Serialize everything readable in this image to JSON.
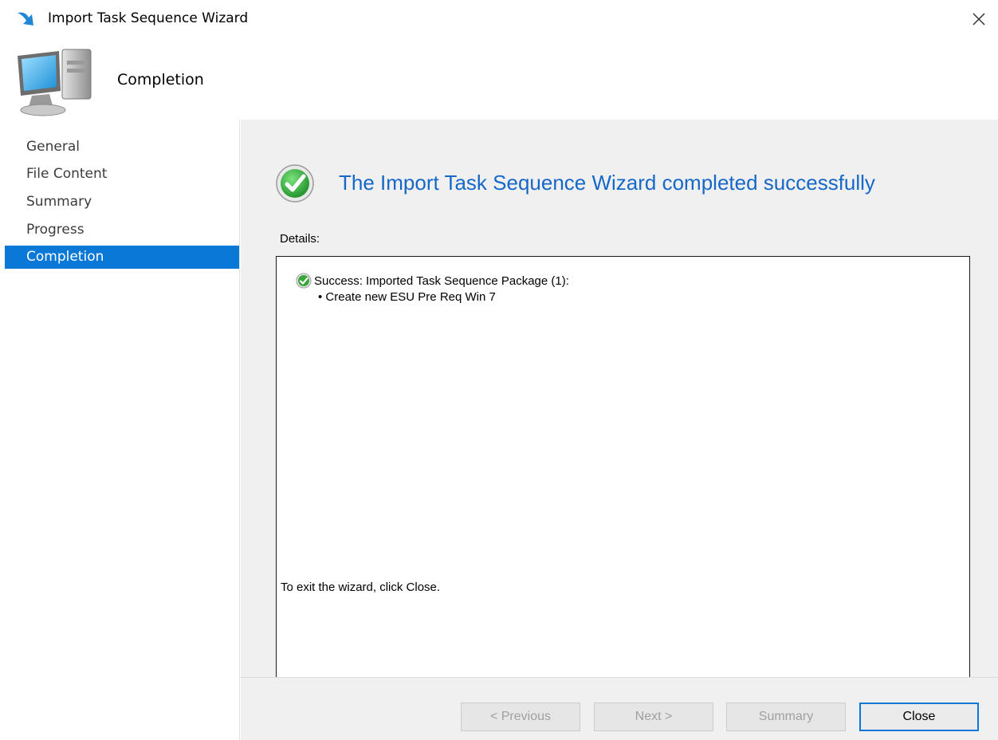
{
  "window": {
    "title": "Import Task Sequence Wizard"
  },
  "header": {
    "title": "Completion"
  },
  "sidebar": {
    "items": [
      {
        "label": "General",
        "active": false
      },
      {
        "label": "File Content",
        "active": false
      },
      {
        "label": "Summary",
        "active": false
      },
      {
        "label": "Progress",
        "active": false
      },
      {
        "label": "Completion",
        "active": true
      }
    ]
  },
  "main": {
    "heading": "The Import Task Sequence Wizard completed successfully",
    "details_label": "Details:",
    "details": {
      "line1": "Success: Imported Task Sequence Package (1):",
      "line2": "• Create new ESU Pre Req Win 7"
    },
    "exit_text": "To exit the wizard, click Close."
  },
  "footer": {
    "previous": "< Previous",
    "next": "Next >",
    "summary": "Summary",
    "close": "Close"
  },
  "colors": {
    "accent": "#0a78d7",
    "heading": "#1668c8",
    "success": "#3aa53a"
  },
  "icons": [
    "wizard-arrow-icon",
    "close-icon",
    "computer-icon",
    "success-check-icon"
  ]
}
